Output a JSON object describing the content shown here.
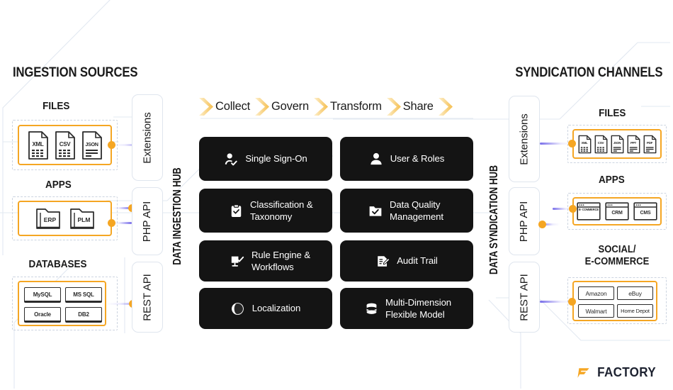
{
  "left": {
    "section_title": "INGESTION SOURCES",
    "hub_label": "DATA INGESTION HUB",
    "groups": [
      {
        "title": "FILES",
        "kind": "file",
        "items": [
          {
            "label": "XML"
          },
          {
            "label": "CSV"
          },
          {
            "label": "JSON"
          }
        ]
      },
      {
        "title": "APPS",
        "kind": "folder",
        "items": [
          {
            "label": "ERP"
          },
          {
            "label": "PLM"
          }
        ]
      },
      {
        "title": "DATABASES",
        "kind": "db",
        "items": [
          {
            "label": "MySQL"
          },
          {
            "label": "MS SQL"
          },
          {
            "label": "Oracle"
          },
          {
            "label": "DB2"
          }
        ]
      }
    ],
    "apis": [
      {
        "label": "Extensions"
      },
      {
        "label": "PHP API"
      },
      {
        "label": "REST API"
      }
    ]
  },
  "right": {
    "section_title": "SYNDICATION CHANNELS",
    "hub_label": "DATA SYNDICATION HUB",
    "groups": [
      {
        "title": "FILES",
        "kind": "file",
        "items": [
          {
            "label": "XML"
          },
          {
            "label": "CSV"
          },
          {
            "label": "JSON"
          },
          {
            "label": "PPT"
          },
          {
            "label": "PDF"
          }
        ]
      },
      {
        "title": "APPS",
        "kind": "window",
        "items": [
          {
            "label": "E-\nCOMMERCE"
          },
          {
            "label": "CRM"
          },
          {
            "label": "CMS"
          }
        ]
      },
      {
        "title": "SOCIAL/\nE-COMMERCE",
        "kind": "commerce",
        "items": [
          {
            "label": "Amazon"
          },
          {
            "label": "eBuy"
          },
          {
            "label": "Walmart"
          },
          {
            "label": "Home Depot"
          }
        ]
      }
    ],
    "apis": [
      {
        "label": "Extensions"
      },
      {
        "label": "PHP API"
      },
      {
        "label": "REST API"
      }
    ]
  },
  "process": {
    "steps": [
      {
        "label": "Collect"
      },
      {
        "label": "Govern"
      },
      {
        "label": "Transform"
      },
      {
        "label": "Share"
      }
    ]
  },
  "features": [
    {
      "label": "Single Sign-On",
      "icon": "person-check-icon"
    },
    {
      "label": "User & Roles",
      "icon": "person-icon"
    },
    {
      "label": "Classification &\nTaxonomy",
      "icon": "clipboard-check-icon"
    },
    {
      "label": "Data Quality\nManagement",
      "icon": "folder-check-icon"
    },
    {
      "label": "Rule Engine &\nWorkflows",
      "icon": "monitor-check-icon"
    },
    {
      "label": "Audit Trail",
      "icon": "document-edit-icon"
    },
    {
      "label": "Localization",
      "icon": "globe-icon"
    },
    {
      "label": "Multi-Dimension\nFlexible Model",
      "icon": "database-stack-icon"
    }
  ],
  "logo": {
    "wordmark": "FACTORY",
    "mark": "f-mark-icon"
  },
  "colors": {
    "accent_orange": "#F5A623",
    "card_dark": "#141414",
    "connector_purple": "#6255E6",
    "guide_line": "#dfe5ee",
    "text_dark": "#1a1a1a"
  }
}
